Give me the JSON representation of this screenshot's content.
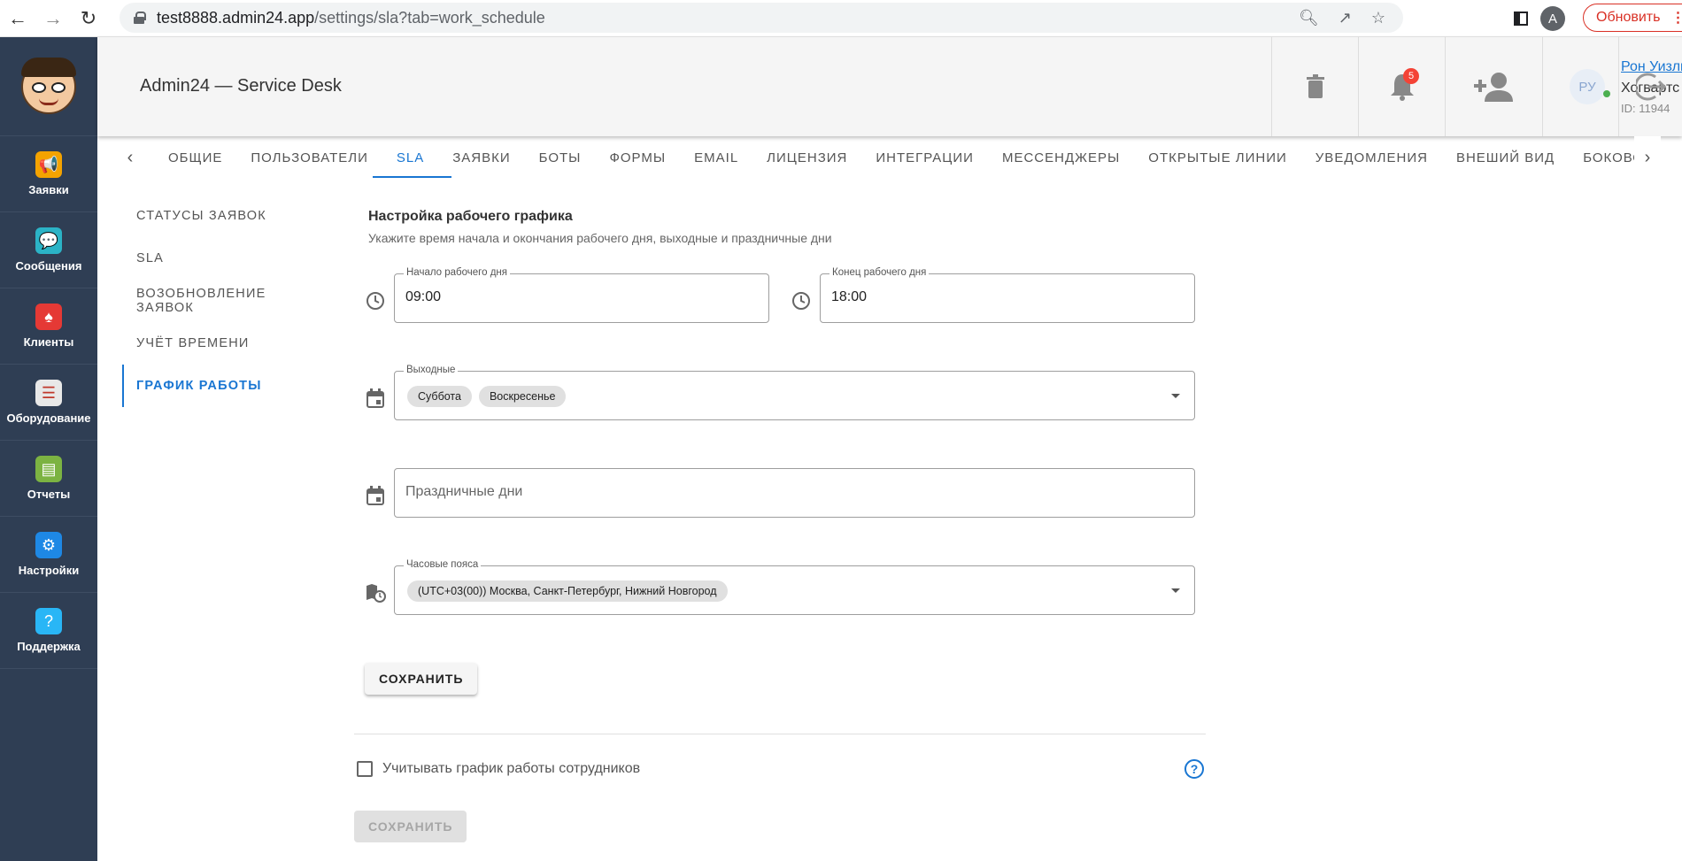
{
  "browser": {
    "url_host": "test8888.admin24.app",
    "url_path": "/settings/sla?tab=work_schedule",
    "profile_initial": "A",
    "update_label": "Обновить"
  },
  "sidebar": {
    "items": [
      {
        "label": "Заявки",
        "icon": "megaphone-icon",
        "color": "#f4a300"
      },
      {
        "label": "Сообщения",
        "icon": "chat-icon",
        "color": "#2bb3c6"
      },
      {
        "label": "Клиенты",
        "icon": "clients-icon",
        "color": "#e53935"
      },
      {
        "label": "Оборудование",
        "icon": "equipment-icon",
        "color": "#e8e8e8"
      },
      {
        "label": "Отчеты",
        "icon": "reports-icon",
        "color": "#7cb342"
      },
      {
        "label": "Настройки",
        "icon": "gear-icon",
        "color": "#1e88e5"
      },
      {
        "label": "Поддержка",
        "icon": "help-icon",
        "color": "#29b6f6"
      }
    ]
  },
  "header": {
    "title": "Admin24 — Service Desk",
    "notifications_count": "5",
    "user": {
      "initials": "РУ",
      "name": "Рон Уизли",
      "org": "Хогвартс",
      "id": "ID: 11944"
    }
  },
  "tabs": [
    {
      "label": "ОБЩИЕ"
    },
    {
      "label": "ПОЛЬЗОВАТЕЛИ"
    },
    {
      "label": "SLA",
      "active": true
    },
    {
      "label": "ЗАЯВКИ"
    },
    {
      "label": "БОТЫ"
    },
    {
      "label": "ФОРМЫ"
    },
    {
      "label": "EMAIL"
    },
    {
      "label": "ЛИЦЕНЗИЯ"
    },
    {
      "label": "ИНТЕГРАЦИИ"
    },
    {
      "label": "МЕССЕНДЖЕРЫ"
    },
    {
      "label": "ОТКРЫТЫЕ ЛИНИИ"
    },
    {
      "label": "УВЕДОМЛЕНИЯ"
    },
    {
      "label": "ВНЕШИЙ ВИД"
    },
    {
      "label": "БОКОВОЕ"
    }
  ],
  "subnav": [
    {
      "label": "Статусы заявок"
    },
    {
      "label": "SLA"
    },
    {
      "label": "Возобновление заявок"
    },
    {
      "label": "Учёт времени"
    },
    {
      "label": "График работы",
      "active": true
    }
  ],
  "form": {
    "title": "Настройка рабочего графика",
    "subtitle": "Укажите время начала и окончания рабочего дня, выходные и праздничные дни",
    "start_label": "Начало рабочего дня",
    "start_value": "09:00",
    "end_label": "Конец рабочего дня",
    "end_value": "18:00",
    "weekends_label": "Выходные",
    "weekends": [
      "Суббота",
      "Воскресенье"
    ],
    "holidays_placeholder": "Праздничные дни",
    "timezone_label": "Часовые пояса",
    "timezone_value": "(UTC+03(00)) Москва, Санкт-Петербург, Нижний Новгород",
    "save_label": "СОХРАНИТЬ",
    "employee_schedule_label": "Учитывать график работы сотрудников",
    "employee_schedule_checked": false,
    "save2_label": "СОХРАНИТЬ"
  },
  "colors": {
    "accent": "#1976d2",
    "sidebar_bg": "#2f3e54",
    "badge": "#f44336"
  }
}
